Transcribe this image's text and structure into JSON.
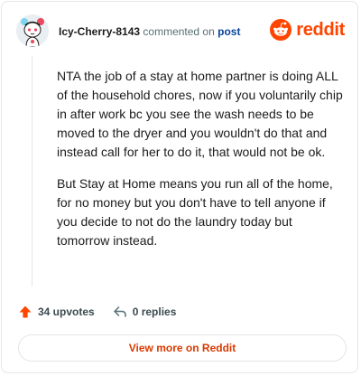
{
  "comment": {
    "username": "Icy-Cherry-8143",
    "action_text": "commented on",
    "post_link_text": "post",
    "paragraphs": [
      "NTA the job of a stay at home partner is doing ALL of the household chores, now if you voluntarily chip in after work bc you see the wash needs to be moved to the dryer and you wouldn't do that and instead call for her to do it, that would not be ok.",
      "But Stay at Home means you run all of the home, for no money but you don't have to tell anyone if you decide to not do the laundry today but tomorrow instead."
    ],
    "upvotes_label": "34 upvotes",
    "replies_label": "0 replies"
  },
  "brand": {
    "name": "reddit",
    "icon": "reddit-snoo-icon",
    "color": "#ff4500"
  },
  "view_more_label": "View more on Reddit"
}
